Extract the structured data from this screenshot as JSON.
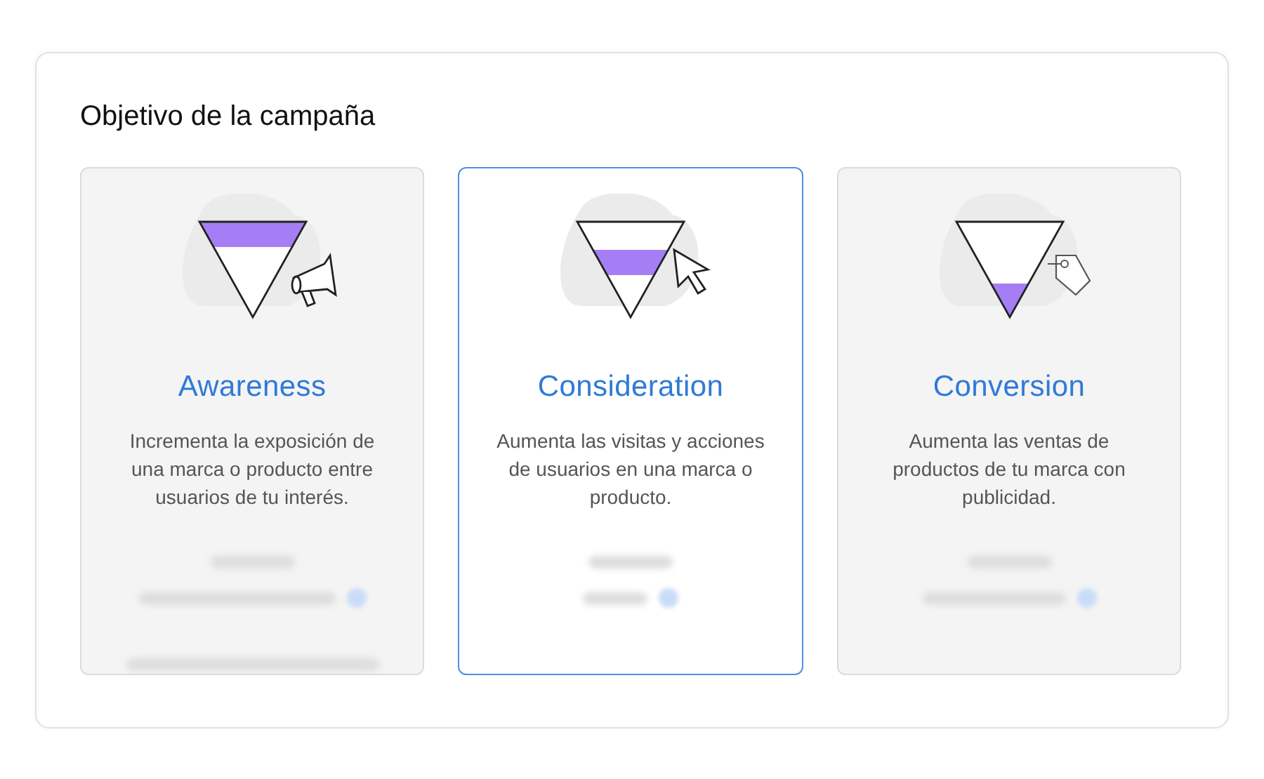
{
  "title": "Objetivo de la campaña",
  "cards": [
    {
      "name": "Awareness",
      "description": "Incrementa la exposición de una marca o producto entre usuarios de tu interés.",
      "selected": false,
      "kind": "megaphone",
      "details": [
        {
          "kind": "heading"
        },
        {
          "kind": "metric"
        },
        {
          "kind": "note"
        }
      ]
    },
    {
      "name": "Consideration",
      "description": "Aumenta las visitas y acciones de usuarios en una marca o producto.",
      "selected": true,
      "kind": "cursor",
      "details": [
        {
          "kind": "heading"
        },
        {
          "kind": "metric"
        }
      ]
    },
    {
      "name": "Conversion",
      "description": "Aumenta las ventas de productos de tu marca con publicidad.",
      "selected": false,
      "kind": "tag",
      "details": [
        {
          "kind": "heading"
        },
        {
          "kind": "metric"
        }
      ]
    }
  ]
}
